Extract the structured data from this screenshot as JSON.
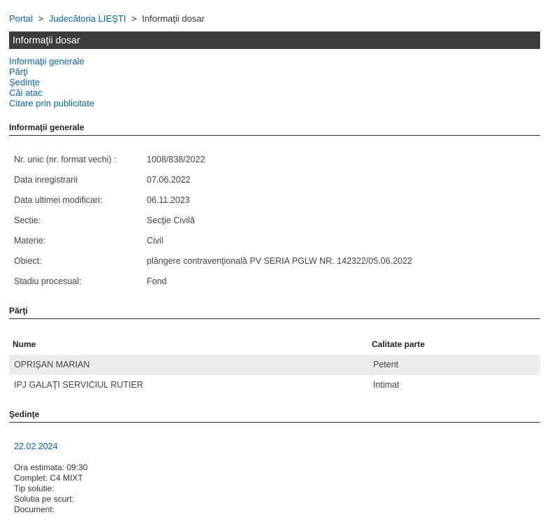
{
  "breadcrumb": {
    "portal": "Portal",
    "court": "Judecătoria LIEŞTI",
    "current": "Informaţii dosar",
    "separator": ">"
  },
  "title": "Informaţii dosar",
  "nav": [
    "Informaţii generale",
    "Părţi",
    "Şedinţe",
    "Căi atac",
    "Citare prin publicitate"
  ],
  "general": {
    "heading": "Informaţii generale",
    "rows": [
      {
        "label": "Nr. unic (nr. format vechi) :",
        "value": "1008/838/2022"
      },
      {
        "label": "Data inregistrarii",
        "value": "07.06.2022"
      },
      {
        "label": "Data ultimei modificari:",
        "value": "06.11.2023"
      },
      {
        "label": "Sectie:",
        "value": "Secţie Civilă"
      },
      {
        "label": "Materie:",
        "value": "Civil"
      },
      {
        "label": "Obiect:",
        "value": "plângere contravenţională PV SERIA PGLW NR. 142322/05.06.2022"
      },
      {
        "label": "Stadiu procesual:",
        "value": "Fond"
      }
    ]
  },
  "parti": {
    "heading": "Părţi",
    "col_name": "Nume",
    "col_role": "Calitate parte",
    "rows": [
      {
        "name": "OPRIŞAN MARIAN",
        "role": "Petent"
      },
      {
        "name": "IPJ GALAŢI SERVICIUL RUTIER",
        "role": "Intimat"
      }
    ]
  },
  "sedinte": {
    "heading": "Şedinţe",
    "date": "22.02.2024",
    "lines": [
      "Ora estimata: 09:30",
      "Complet: C4 MIXT",
      "Tip solutie:",
      "Solutia pe scurt:",
      "Document:"
    ]
  }
}
